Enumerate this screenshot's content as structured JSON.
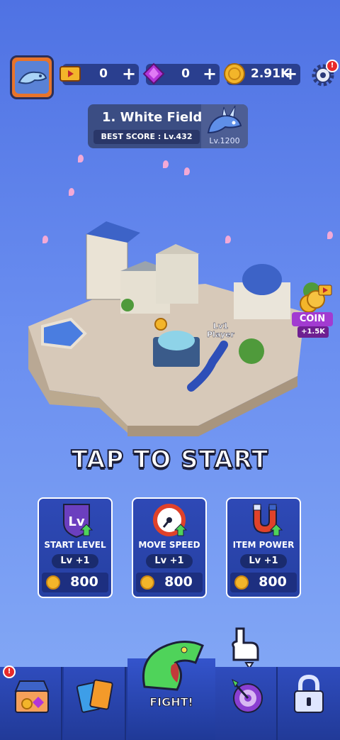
{
  "resources": {
    "tickets": {
      "value": "0",
      "plus": "+"
    },
    "gems": {
      "value": "0",
      "plus": "+"
    },
    "coins": {
      "value": "2.91K",
      "plus": "+"
    }
  },
  "settings_alert": "!",
  "stage": {
    "title": "1. White Field",
    "best_score": "BEST SCORE : Lv.432",
    "boss_level": "Lv.1200"
  },
  "map": {
    "player_level": "Lv1",
    "player_label": "Player",
    "coin_offer": {
      "label": "COIN",
      "amount": "+1.5K"
    }
  },
  "tap_to_start": "TAP TO START",
  "upgrades": [
    {
      "name": "START LEVEL",
      "level": "Lv +1",
      "cost": "800"
    },
    {
      "name": "MOVE SPEED",
      "level": "Lv +1",
      "cost": "800"
    },
    {
      "name": "ITEM POWER",
      "level": "Lv +1",
      "cost": "800"
    }
  ],
  "nav": {
    "shop_alert": "!",
    "fight_label": "FIGHT!"
  },
  "colors": {
    "background_top": "#4f72e3",
    "panel_blue": "#2a3f8f",
    "coin_gold": "#f3b52a",
    "gem_purple": "#b235d9",
    "avatar_orange": "#e8742a"
  }
}
